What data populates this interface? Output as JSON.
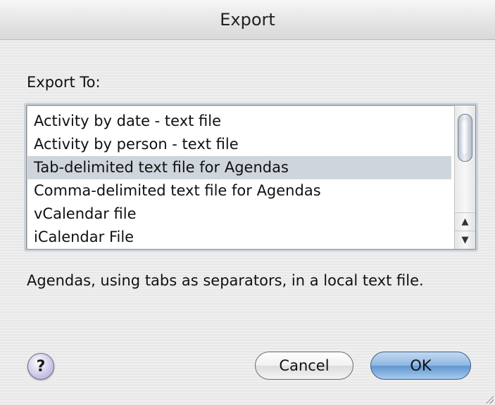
{
  "window": {
    "title": "Export"
  },
  "export_to": {
    "label": "Export To:",
    "items": [
      "Activity by date - text file",
      "Activity by person - text file",
      "Tab-delimited text file for Agendas",
      "Comma-delimited text file for Agendas",
      "vCalendar file",
      "iCalendar File"
    ],
    "selected_index": 2
  },
  "description": "Agendas, using tabs as separators, in a local text file.",
  "buttons": {
    "help": "?",
    "cancel": "Cancel",
    "ok": "OK"
  },
  "scrollbar": {
    "up_arrow": "▲",
    "down_arrow": "▼"
  },
  "icons": {
    "help": "help-icon",
    "scroll_up": "scroll-up-arrow-icon",
    "scroll_down": "scroll-down-arrow-icon",
    "resize_grip": "resize-grip-icon"
  },
  "colors": {
    "selection": "#cfd5dc",
    "default_button": "#8fb6e2",
    "window_background": "#ececec"
  }
}
